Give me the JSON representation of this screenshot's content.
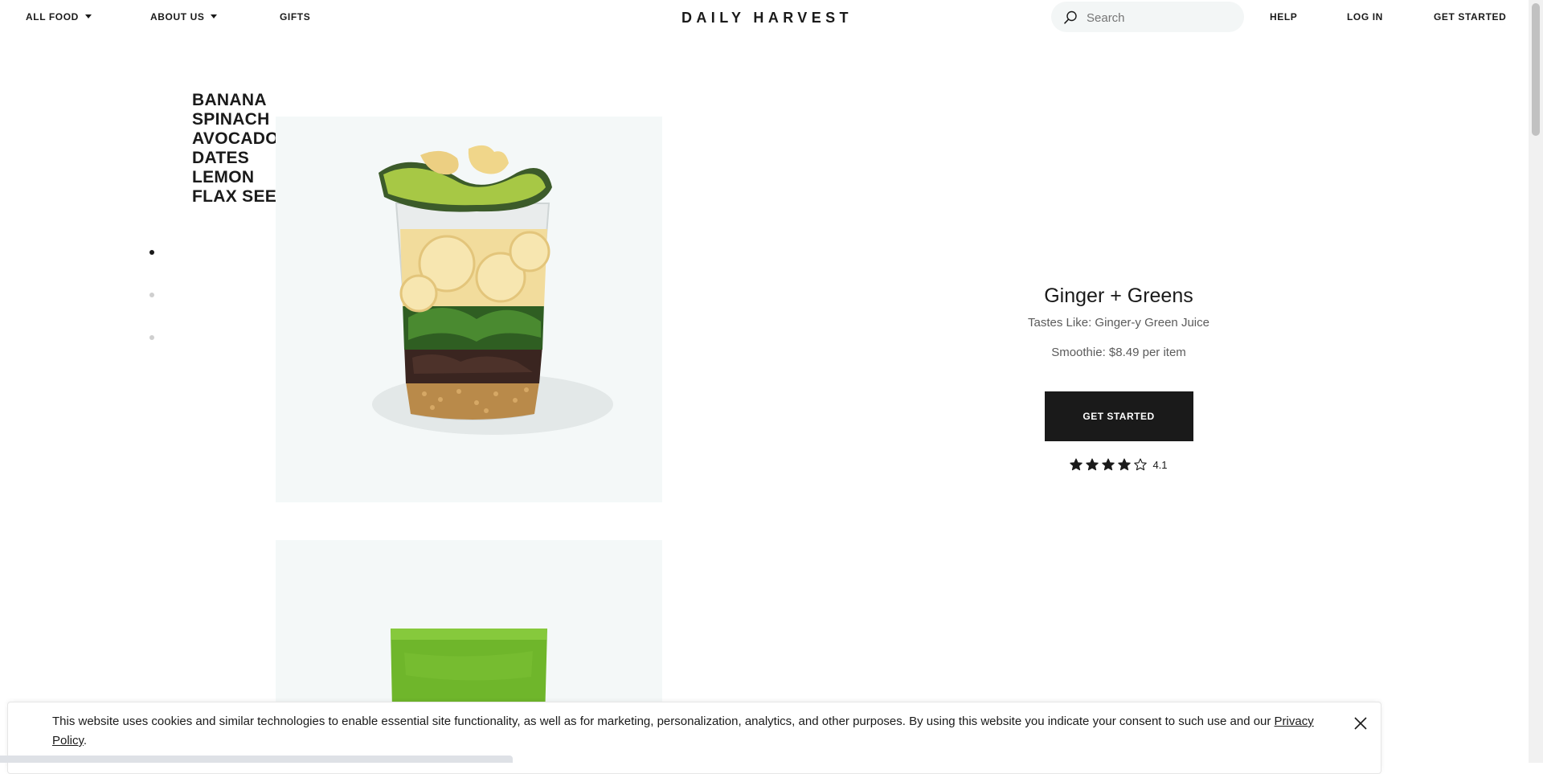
{
  "nav": {
    "all_food": "ALL FOOD",
    "about_us": "ABOUT US",
    "gifts": "GIFTS",
    "logo": "DAILY HARVEST",
    "search_placeholder": "Search",
    "help": "HELP",
    "log_in": "LOG IN",
    "get_started": "GET STARTED"
  },
  "ingredients": [
    "BANANA",
    "SPINACH",
    "AVOCADO",
    "DATES",
    "LEMON",
    "FLAX SEED"
  ],
  "carousel": {
    "slides": 3,
    "active_index": 0
  },
  "product": {
    "name": "Ginger + Greens",
    "tastes_like": "Tastes Like: Ginger-y Green Juice",
    "price": "Smoothie: $8.49 per item",
    "cta_label": "GET STARTED",
    "rating_value": "4.1",
    "rating_stars": 4,
    "rating_max": 5
  },
  "cookie_banner": {
    "text": "This website uses cookies and similar technologies to enable essential site functionality, as well as for marketing, personalization, analytics, and other purposes. By using this website you indicate your consent to such use and our ",
    "link": "Privacy Policy",
    "end": "."
  },
  "colors": {
    "ink": "#1a1a1a",
    "image_bg": "#f4f8f8",
    "search_bg": "#f3f6f6",
    "muted_text": "#5b5b5b",
    "avocado": "#9cc23a",
    "smoothie_green": "#6fb62b",
    "banana": "#f7e6b0"
  },
  "icons": {
    "search": "search-icon",
    "caret": "chevron-down-icon",
    "star": "star-icon",
    "close": "close-icon"
  }
}
